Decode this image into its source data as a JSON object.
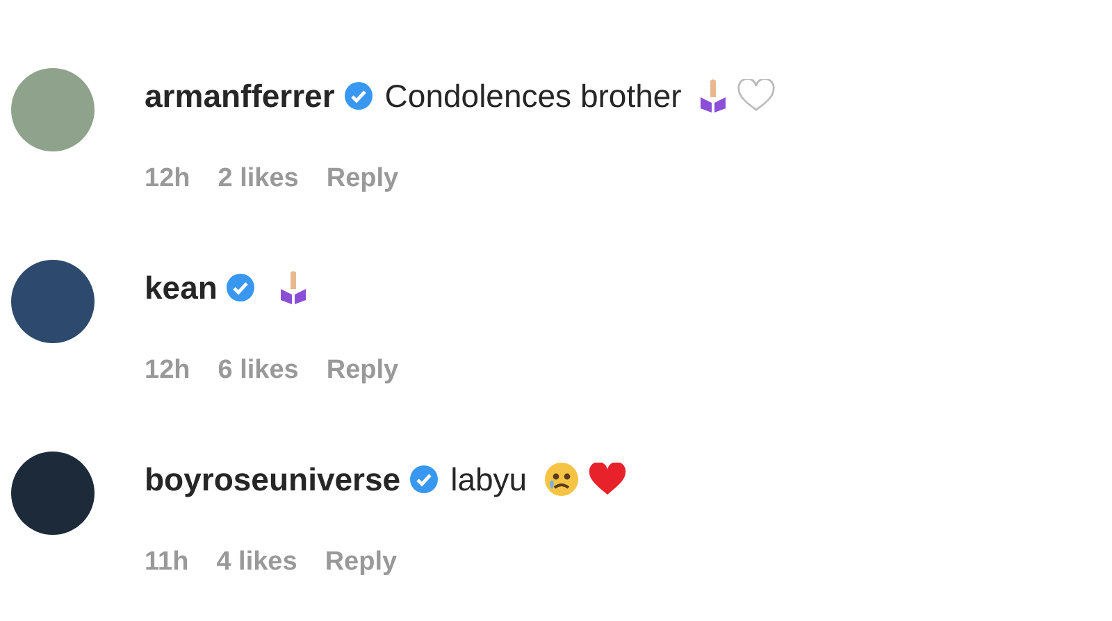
{
  "comments": [
    {
      "username": "armanfferrer",
      "verified": true,
      "text": "Condolences brother",
      "emojis": [
        {
          "kind": "praying-hands"
        }
      ],
      "liked": false,
      "time": "12h",
      "likes": "2 likes",
      "reply": "Reply"
    },
    {
      "username": "kean",
      "verified": true,
      "emojis": [
        {
          "kind": "praying-hands"
        }
      ],
      "time": "12h",
      "likes": "6 likes",
      "reply": "Reply"
    },
    {
      "username": "boyroseuniverse",
      "verified": true,
      "text": "labyu",
      "emojis": [
        {
          "kind": "crying-face"
        },
        {
          "kind": "red-heart"
        }
      ],
      "time": "11h",
      "likes": "4 likes",
      "reply": "Reply"
    }
  ]
}
